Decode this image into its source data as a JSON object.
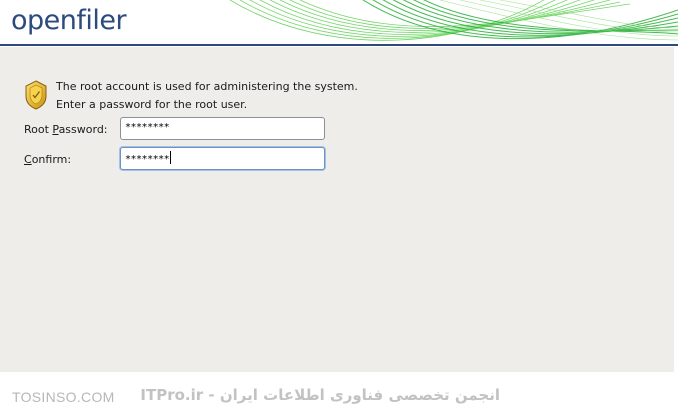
{
  "header": {
    "logo_text": "openfiler"
  },
  "main": {
    "message_line1": "The root account is used for administering the system.",
    "message_line2": "Enter a password for the root user.",
    "root_password": {
      "label_prefix": "Root ",
      "label_accel": "P",
      "label_rest": "assword:",
      "value": "********"
    },
    "confirm": {
      "label_accel": "C",
      "label_rest": "onfirm:",
      "value": "********"
    }
  },
  "footer": {
    "left_text": "TOSINSO.COM",
    "right_text": "ITPro.ir - انجمن تخصصی فناوری اطلاعات ایران"
  },
  "colors": {
    "accent": "#2f4a7a",
    "swoosh_green": "#4cc54a",
    "panel_bg": "#eeedea"
  },
  "icons": {
    "badge": "security-badge-icon"
  }
}
